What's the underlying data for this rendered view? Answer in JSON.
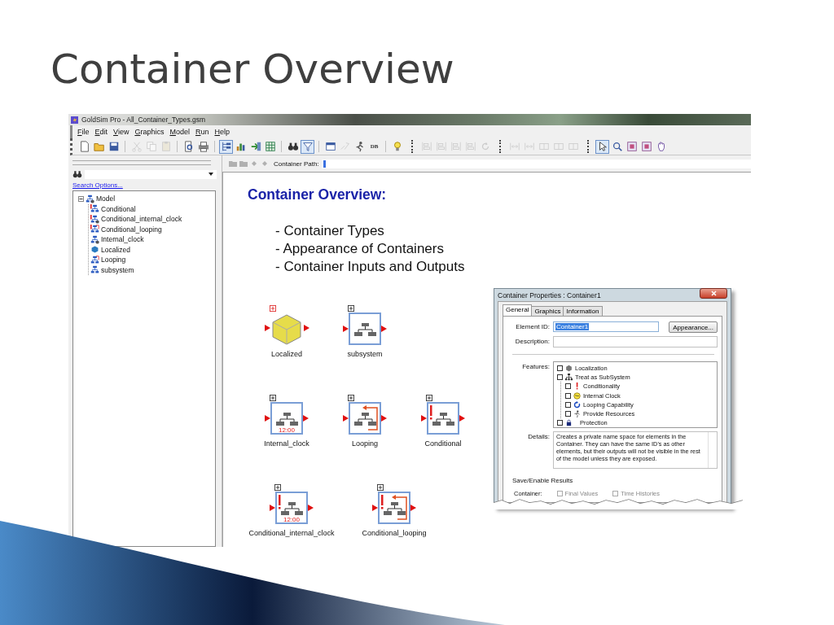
{
  "slide": {
    "title": "Container Overview"
  },
  "window": {
    "title": "GoldSim Pro - All_Container_Types.gsm"
  },
  "menu": [
    "File",
    "Edit",
    "View",
    "Graphics",
    "Model",
    "Run",
    "Help"
  ],
  "toolbar": [
    {
      "kind": "new",
      "pressed": false,
      "disabled": false
    },
    {
      "kind": "open",
      "pressed": false,
      "disabled": false
    },
    {
      "kind": "save",
      "pressed": false,
      "disabled": false
    },
    {
      "kind": "separator"
    },
    {
      "kind": "cut",
      "pressed": false,
      "disabled": true
    },
    {
      "kind": "copy",
      "pressed": false,
      "disabled": true
    },
    {
      "kind": "paste",
      "pressed": false,
      "disabled": true
    },
    {
      "kind": "separator"
    },
    {
      "kind": "preview",
      "pressed": false,
      "disabled": false
    },
    {
      "kind": "print",
      "pressed": false,
      "disabled": false
    },
    {
      "kind": "separator"
    },
    {
      "kind": "tree",
      "pressed": true,
      "disabled": false
    },
    {
      "kind": "chart",
      "pressed": false,
      "disabled": false
    },
    {
      "kind": "import",
      "pressed": false,
      "disabled": false
    },
    {
      "kind": "grid",
      "pressed": false,
      "disabled": false
    },
    {
      "kind": "separator"
    },
    {
      "kind": "find",
      "pressed": false,
      "disabled": false
    },
    {
      "kind": "filter",
      "pressed": true,
      "disabled": false
    },
    {
      "kind": "separator"
    },
    {
      "kind": "window",
      "pressed": false,
      "disabled": false
    },
    {
      "kind": "link",
      "pressed": false,
      "disabled": true
    },
    {
      "kind": "run",
      "pressed": false,
      "disabled": false
    },
    {
      "kind": "db",
      "label": "DB",
      "pressed": false,
      "disabled": false
    },
    {
      "kind": "separator"
    },
    {
      "kind": "bulb",
      "pressed": false,
      "disabled": false
    },
    {
      "kind": "grip"
    },
    {
      "kind": "align",
      "pressed": false,
      "disabled": true
    },
    {
      "kind": "align",
      "pressed": false,
      "disabled": true
    },
    {
      "kind": "align",
      "pressed": false,
      "disabled": true
    },
    {
      "kind": "align",
      "pressed": false,
      "disabled": true
    },
    {
      "kind": "rotate",
      "pressed": false,
      "disabled": true
    },
    {
      "kind": "grip"
    },
    {
      "kind": "space",
      "pressed": false,
      "disabled": true
    },
    {
      "kind": "space",
      "pressed": false,
      "disabled": true
    },
    {
      "kind": "size",
      "pressed": false,
      "disabled": true
    },
    {
      "kind": "size",
      "pressed": false,
      "disabled": true
    },
    {
      "kind": "size",
      "pressed": false,
      "disabled": true
    },
    {
      "kind": "grip"
    },
    {
      "kind": "pointer",
      "pressed": true,
      "disabled": false
    },
    {
      "kind": "zoom",
      "pressed": false,
      "disabled": false
    },
    {
      "kind": "frame",
      "pressed": false,
      "disabled": false
    },
    {
      "kind": "frame",
      "pressed": false,
      "disabled": false
    },
    {
      "kind": "hand",
      "pressed": false,
      "disabled": false
    }
  ],
  "search": {
    "options_link": "Search Options..."
  },
  "tree": {
    "label": "Model",
    "expanded": true,
    "children": [
      {
        "label": "Conditional",
        "kind": "conditional"
      },
      {
        "label": "Conditional_internal_clock",
        "kind": "conditional_clock"
      },
      {
        "label": "Conditional_looping",
        "kind": "conditional_looping"
      },
      {
        "label": "Internal_clock",
        "kind": "clock"
      },
      {
        "label": "Localized",
        "kind": "localized"
      },
      {
        "label": "Looping",
        "kind": "looping"
      },
      {
        "label": "subsystem",
        "kind": "container"
      }
    ]
  },
  "path_bar": {
    "label": "Container Path:"
  },
  "canvas": {
    "heading": "Container Overview:",
    "bullets": [
      "- Container Types",
      "- Appearance of Containers",
      "- Container Inputs and Outputs"
    ],
    "node_rows": [
      [
        {
          "label": "Localized",
          "kind": "localized"
        },
        {
          "label": "subsystem",
          "kind": "container",
          "conditional": false,
          "looping": false
        }
      ],
      [
        {
          "label": "Internal_clock",
          "kind": "container",
          "clock": "12:00",
          "conditional": false,
          "looping": false
        },
        {
          "label": "Looping",
          "kind": "container",
          "conditional": false,
          "looping": true
        },
        {
          "label": "Conditional",
          "kind": "container",
          "conditional": true,
          "looping": false
        }
      ],
      [
        {
          "label": "Conditional_internal_clock",
          "kind": "container",
          "clock": "12:00",
          "conditional": true,
          "looping": false
        },
        {
          "label": "Conditional_looping",
          "kind": "container",
          "conditional": true,
          "looping": true
        }
      ]
    ]
  },
  "dialog": {
    "title": "Container Properties : Container1",
    "tabs": [
      {
        "label": "General",
        "selected": true
      },
      {
        "label": "Graphics",
        "selected": false
      },
      {
        "label": "Information",
        "selected": false
      }
    ],
    "element_id": {
      "label": "Element ID:",
      "value": "Container1"
    },
    "appearance_button": "Appearance...",
    "description": {
      "label": "Description:"
    },
    "features_label": "Features:",
    "features": [
      {
        "label": "Localization",
        "kind": "localization",
        "checked": false
      },
      {
        "label": "Treat as SubSystem",
        "kind": "subsystem",
        "checked": false,
        "children": [
          {
            "label": "Conditionality",
            "kind": "conditionality",
            "checked": false
          },
          {
            "label": "Internal Clock",
            "kind": "clock",
            "checked": false
          },
          {
            "label": "Looping Capability",
            "kind": "looping",
            "checked": false
          },
          {
            "label": "Provide Resources",
            "kind": "resources",
            "checked": false
          }
        ]
      },
      {
        "label": "Protection",
        "kind": "protection",
        "checked": false
      }
    ],
    "details_label": "Details:",
    "details": "Creates a private name space for elements in the Container. They can have the same ID's as other elements, but their outputs will not be visible in the rest of the model unless they are exposed.",
    "results_group": "Save/Enable Results",
    "results_row": {
      "label": "Container:",
      "options": [
        {
          "label": "Final Values",
          "checked": false
        },
        {
          "label": "Time Histories",
          "checked": false
        }
      ]
    }
  }
}
